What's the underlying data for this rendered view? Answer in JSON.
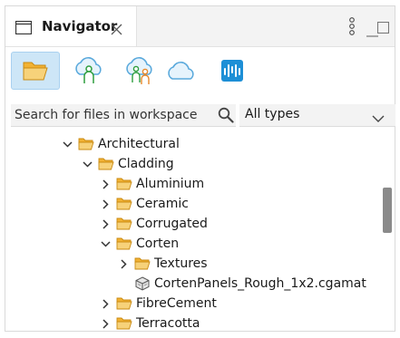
{
  "tab": {
    "title": "Navigator"
  },
  "toolbar": {
    "buttons": [
      {
        "name": "open-folder-button",
        "active": true
      },
      {
        "name": "cloud-user-button",
        "active": false
      },
      {
        "name": "cloud-users-button",
        "active": false
      },
      {
        "name": "cloud-button",
        "active": false
      },
      {
        "name": "app-logo-button",
        "active": false
      }
    ]
  },
  "search": {
    "placeholder": "Search for files in workspace"
  },
  "filter": {
    "selected": "All types"
  },
  "tree": [
    {
      "label": "Architectural",
      "expanded": true,
      "type": "folder"
    },
    {
      "label": "Cladding",
      "expanded": true,
      "type": "folder"
    },
    {
      "label": "Aluminium",
      "expanded": false,
      "type": "folder"
    },
    {
      "label": "Ceramic",
      "expanded": false,
      "type": "folder"
    },
    {
      "label": "Corrugated",
      "expanded": false,
      "type": "folder"
    },
    {
      "label": "Corten",
      "expanded": true,
      "type": "folder"
    },
    {
      "label": "Textures",
      "expanded": false,
      "type": "folder"
    },
    {
      "label": "CortenPanels_Rough_1x2.cgamat",
      "type": "file"
    },
    {
      "label": "FibreCement",
      "expanded": false,
      "type": "folder"
    },
    {
      "label": "Terracotta",
      "expanded": false,
      "type": "folder"
    }
  ],
  "colors": {
    "folder": "#f2b233",
    "accent_bg": "#cde6f7",
    "cloud": "#5aa9dc",
    "user_green": "#2e9e3e",
    "user_orange": "#e8882a"
  }
}
